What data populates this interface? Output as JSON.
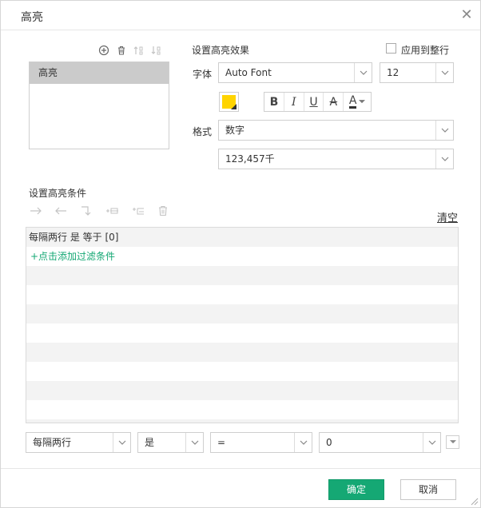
{
  "dialog": {
    "title": "高亮"
  },
  "highlight_list": {
    "items": [
      "高亮"
    ],
    "selected_index": 0
  },
  "effect": {
    "section_label": "设置高亮效果",
    "apply_whole_row_label": "应用到整行",
    "apply_whole_row_checked": false,
    "font_label": "字体",
    "font_value": "Auto Font",
    "size_value": "12",
    "color": "#ffd400",
    "format_label": "格式",
    "format_value": "数字",
    "number_format_value": "123,457千",
    "style_buttons": [
      "B",
      "I",
      "U",
      "A",
      "A"
    ]
  },
  "conditions": {
    "section_label": "设置高亮条件",
    "clear_label": "清空",
    "rows": [
      "每隔两行 是 等于 [0]",
      "+点击添加过滤条件"
    ],
    "add_link_color": "#15a874"
  },
  "editor": {
    "field_value": "每隔两行",
    "operator1_value": "是",
    "operator2_value": "=",
    "value_value": "0"
  },
  "footer": {
    "ok_label": "确定",
    "cancel_label": "取消",
    "ok_color": "#15a874"
  },
  "icons": [
    "add-icon",
    "delete-icon",
    "move-up-icon",
    "move-down-icon",
    "indent-icon",
    "outdent-icon",
    "move-to-parent-icon",
    "add-group-icon",
    "add-subgroup-icon",
    "delete-condition-icon",
    "close-icon",
    "chevron-down-icon",
    "resize-icon"
  ]
}
